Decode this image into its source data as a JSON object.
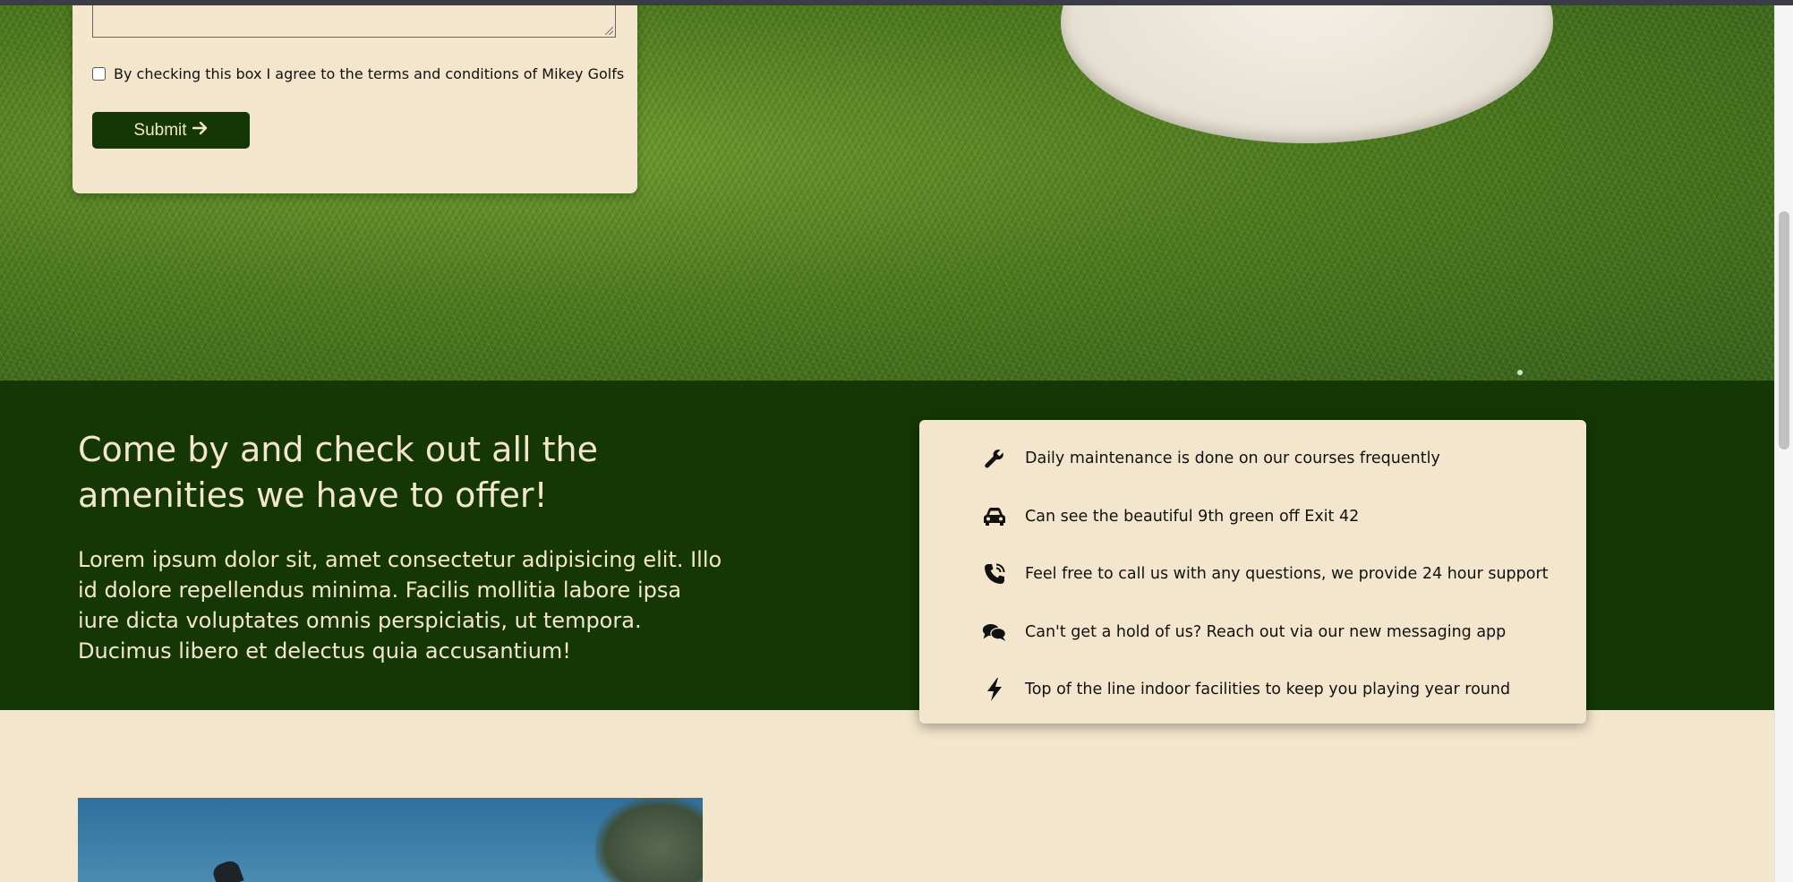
{
  "form": {
    "terms_label": "By checking this box I agree to the terms and conditions of Mikey Golfs",
    "submit_label": "Submit",
    "submit_icon": "arrow-right-icon"
  },
  "amenities": {
    "heading": "Come by and check out all the amenities we have to offer!",
    "body": "Lorem ipsum dolor sit, amet consectetur adipisicing elit. Illo id dolore repellendus minima. Facilis mollitia labore ipsa iure dicta voluptates omnis perspiciatis, ut tempora. Ducimus libero et delectus quia accusantium!"
  },
  "features": [
    {
      "icon": "wrench-icon",
      "text": "Daily maintenance is done on our courses frequently"
    },
    {
      "icon": "car-icon",
      "text": "Can see the beautiful 9th green off Exit 42"
    },
    {
      "icon": "phone-icon",
      "text": "Feel free to call us with any questions, we provide 24 hour support"
    },
    {
      "icon": "chat-icon",
      "text": "Can't get a hold of us? Reach out via our new messaging app"
    },
    {
      "icon": "bolt-icon",
      "text": "Top of the line indoor facilities to keep you playing year round"
    }
  ],
  "colors": {
    "dark_green": "#143705",
    "cream": "#f3e6cd"
  }
}
